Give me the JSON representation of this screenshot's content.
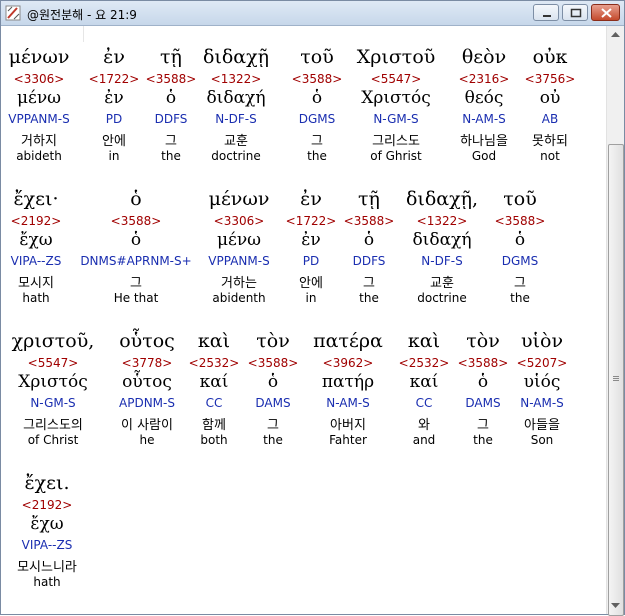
{
  "window": {
    "title": "@원전분해 - 요 21:9"
  },
  "rows": [
    [
      {
        "greek": "μένων",
        "strong": "<3306>",
        "lemma": "μένω",
        "parse": "VPPANM-S",
        "korean": "거하지",
        "english": "abideth"
      },
      {
        "greek": "ἐν",
        "strong": "<1722>",
        "lemma": "ἐν",
        "parse": "PD",
        "korean": "안에",
        "english": "in"
      },
      {
        "greek": "τῇ",
        "strong": "<3588>",
        "lemma": "ὁ",
        "parse": "DDFS",
        "korean": "그",
        "english": "the"
      },
      {
        "greek": "διδαχῇ",
        "strong": "<1322>",
        "lemma": "διδαχή",
        "parse": "N-DF-S",
        "korean": "교훈",
        "english": "doctrine"
      },
      {
        "greek": "τοῦ",
        "strong": "<3588>",
        "lemma": "ὁ",
        "parse": "DGMS",
        "korean": "그",
        "english": "the"
      },
      {
        "greek": "Χριστοῦ",
        "strong": "<5547>",
        "lemma": "Χριστός",
        "parse": "N-GM-S",
        "korean": "그리스도",
        "english": "of Ghrist"
      },
      {
        "greek": "θεὸν",
        "strong": "<2316>",
        "lemma": "θεός",
        "parse": "N-AM-S",
        "korean": "하나님을",
        "english": "God"
      },
      {
        "greek": "οὐκ",
        "strong": "<3756>",
        "lemma": "οὐ",
        "parse": "AB",
        "korean": "못하되",
        "english": "not"
      }
    ],
    [
      {
        "greek": "ἔχει·",
        "strong": "<2192>",
        "lemma": "ἔχω",
        "parse": "VIPA--ZS",
        "korean": "모시지",
        "english": "hath"
      },
      {
        "greek": "ὁ",
        "strong": "<3588>",
        "lemma": "ὁ",
        "parse": "DNMS#APRNM-S+",
        "korean": "그",
        "english": "He that"
      },
      {
        "greek": "μένων",
        "strong": "<3306>",
        "lemma": "μένω",
        "parse": "VPPANM-S",
        "korean": "거하는",
        "english": "abidenth"
      },
      {
        "greek": "ἐν",
        "strong": "<1722>",
        "lemma": "ἐν",
        "parse": "PD",
        "korean": "안에",
        "english": "in"
      },
      {
        "greek": "τῇ",
        "strong": "<3588>",
        "lemma": "ὁ",
        "parse": "DDFS",
        "korean": "그",
        "english": "the"
      },
      {
        "greek": "διδαχῇ,",
        "strong": "<1322>",
        "lemma": "διδαχή",
        "parse": "N-DF-S",
        "korean": "교훈",
        "english": "doctrine"
      },
      {
        "greek": "τοῦ",
        "strong": "<3588>",
        "lemma": "ὁ",
        "parse": "DGMS",
        "korean": "그",
        "english": "the"
      }
    ],
    [
      {
        "greek": "χριστοῦ,",
        "strong": "<5547>",
        "lemma": "Χριστός",
        "parse": "N-GM-S",
        "korean": "그리스도의",
        "english": "of Christ"
      },
      {
        "greek": "οὗτος",
        "strong": "<3778>",
        "lemma": "οὗτος",
        "parse": "APDNM-S",
        "korean": "이 사람이",
        "english": "he"
      },
      {
        "greek": "καὶ",
        "strong": "<2532>",
        "lemma": "καί",
        "parse": "CC",
        "korean": "함께",
        "english": "both"
      },
      {
        "greek": "τὸν",
        "strong": "<3588>",
        "lemma": "ὁ",
        "parse": "DAMS",
        "korean": "그",
        "english": "the"
      },
      {
        "greek": "πατέρα",
        "strong": "<3962>",
        "lemma": "πατήρ",
        "parse": "N-AM-S",
        "korean": "아버지",
        "english": "Fahter"
      },
      {
        "greek": "καὶ",
        "strong": "<2532>",
        "lemma": "καί",
        "parse": "CC",
        "korean": "와",
        "english": "and"
      },
      {
        "greek": "τὸν",
        "strong": "<3588>",
        "lemma": "ὁ",
        "parse": "DAMS",
        "korean": "그",
        "english": "the"
      },
      {
        "greek": "υἱὸν",
        "strong": "<5207>",
        "lemma": "υἱός",
        "parse": "N-AM-S",
        "korean": "아들을",
        "english": "Son"
      }
    ],
    [
      {
        "greek": "ἔχει.",
        "strong": "<2192>",
        "lemma": "ἔχω",
        "parse": "VIPA--ZS",
        "korean": "모시느니라",
        "english": "hath"
      }
    ]
  ],
  "icons": {
    "app": "manuscript-icon",
    "minimize": "minimize-icon",
    "maximize": "maximize-icon",
    "close": "close-icon"
  }
}
